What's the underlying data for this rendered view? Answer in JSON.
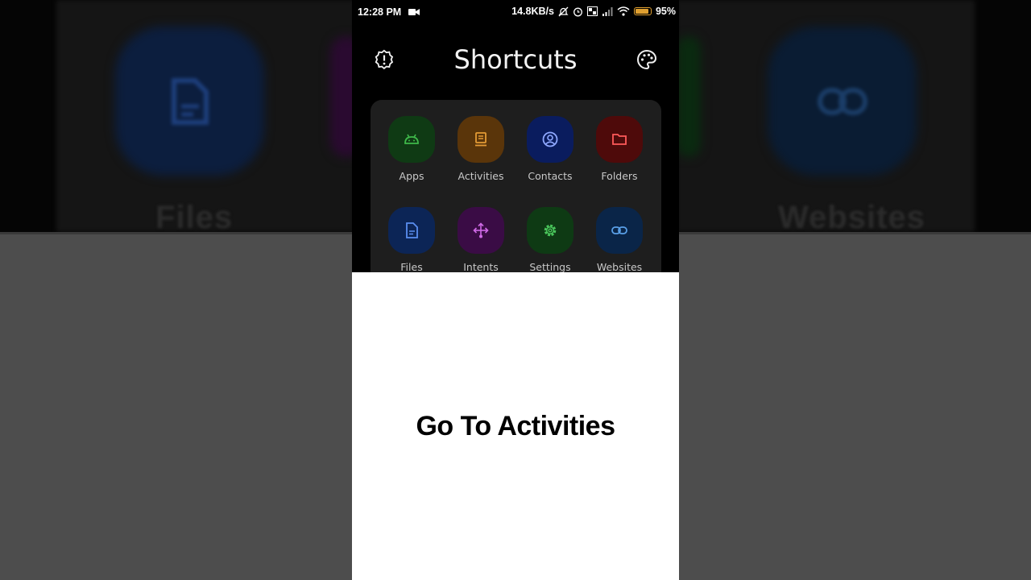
{
  "status_bar": {
    "time": "12:28 PM",
    "speed": "14.8KB/s",
    "battery": "95%",
    "battery_level": 0.95,
    "icons": [
      "video-record-icon",
      "mute-icon",
      "alarm-icon",
      "volte-icon",
      "signal-icon",
      "wifi-icon",
      "battery-icon"
    ]
  },
  "header": {
    "title": "Shortcuts",
    "left_icon": "info-badge-icon",
    "right_icon": "palette-icon"
  },
  "tiles": [
    {
      "label": "Apps",
      "icon": "android-icon",
      "bg": "#0f3a14",
      "fg": "#3fb94a"
    },
    {
      "label": "Activities",
      "icon": "activity-icon",
      "bg": "#5a350a",
      "fg": "#e39a35"
    },
    {
      "label": "Contacts",
      "icon": "contact-icon",
      "bg": "#0a1c5e",
      "fg": "#8fa8ff"
    },
    {
      "label": "Folders",
      "icon": "folder-icon",
      "bg": "#4e0a0a",
      "fg": "#ff5a5a"
    },
    {
      "label": "Files",
      "icon": "file-icon",
      "bg": "#0c2556",
      "fg": "#5a8ef0"
    },
    {
      "label": "Intents",
      "icon": "intent-icon",
      "bg": "#3a0c45",
      "fg": "#cf6ae6"
    },
    {
      "label": "Settings",
      "icon": "settings-icon",
      "bg": "#0e3a14",
      "fg": "#49c45a"
    },
    {
      "label": "Websites",
      "icon": "link-icon",
      "bg": "#0a2548",
      "fg": "#5aa0e8"
    }
  ],
  "background": {
    "left_label": "Files",
    "right_label": "Websites"
  },
  "caption": "Go To Activities"
}
